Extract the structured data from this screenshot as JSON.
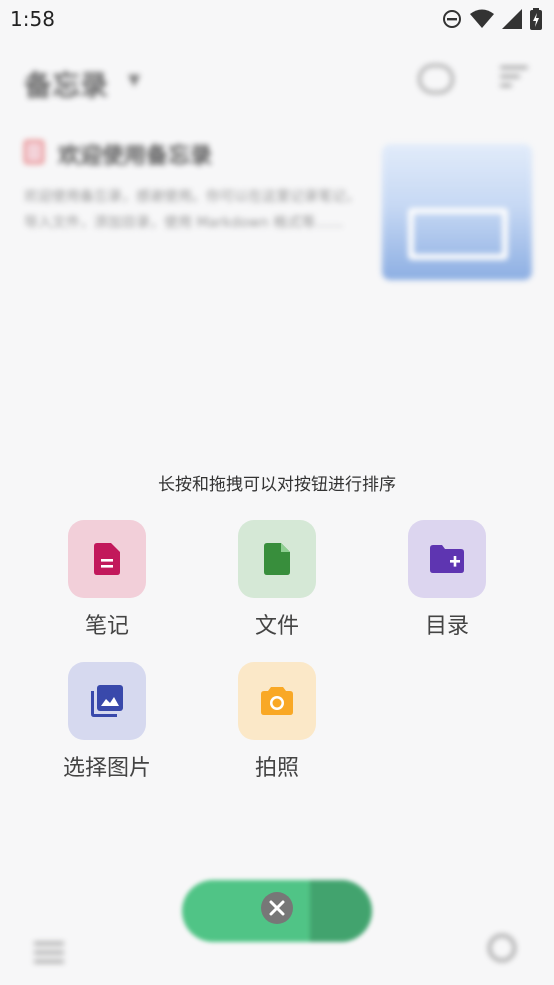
{
  "status_bar": {
    "time": "1:58",
    "icons": [
      "do-not-disturb-icon",
      "wifi-icon",
      "signal-icon",
      "battery-charging-icon"
    ]
  },
  "background": {
    "title": "备忘录",
    "note_title": "欢迎使用备忘录",
    "note_body": "欢迎使用备忘录，感谢使用。你可以在这里记录笔记，导入文件，添加目录，使用 Markdown 格式等……"
  },
  "overlay": {
    "hint": "长按和拖拽可以对按钮进行排序",
    "actions": [
      {
        "label": "笔记",
        "icon": "note-icon",
        "color": "#c2185b",
        "bg": "#f2cfd9"
      },
      {
        "label": "文件",
        "icon": "file-icon",
        "color": "#388e3c",
        "bg": "#d5e8d6"
      },
      {
        "label": "目录",
        "icon": "folder-add-icon",
        "color": "#5e35b1",
        "bg": "#dcd5ef"
      },
      {
        "label": "选择图片",
        "icon": "image-library-icon",
        "color": "#3949ab",
        "bg": "#d6d9ef"
      },
      {
        "label": "拍照",
        "icon": "camera-icon",
        "color": "#f9a825",
        "bg": "#fbe8c8"
      }
    ]
  }
}
